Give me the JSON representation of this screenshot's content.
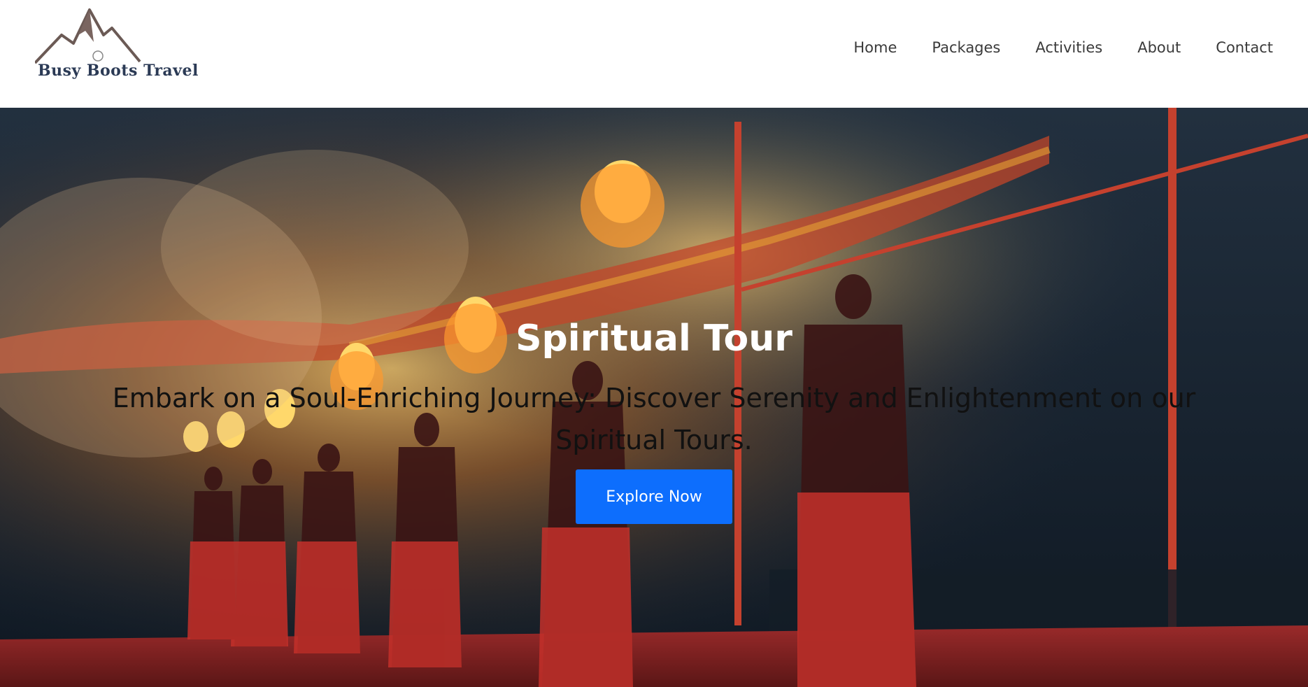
{
  "brand": {
    "logo_text": "Busy Boots Travel"
  },
  "nav": {
    "items": [
      {
        "label": "Home"
      },
      {
        "label": "Packages"
      },
      {
        "label": "Activities"
      },
      {
        "label": "About"
      },
      {
        "label": "Contact"
      }
    ]
  },
  "hero": {
    "title": "Spiritual Tour",
    "subtitle": "Embark on a Soul-Enriching Journey: Discover Serenity and Enlightenment on our Spiritual Tours.",
    "cta_label": "Explore Now"
  },
  "colors": {
    "accent": "#0d6efd",
    "header_bg": "#ffffff",
    "nav_text": "#3a3a3a"
  }
}
